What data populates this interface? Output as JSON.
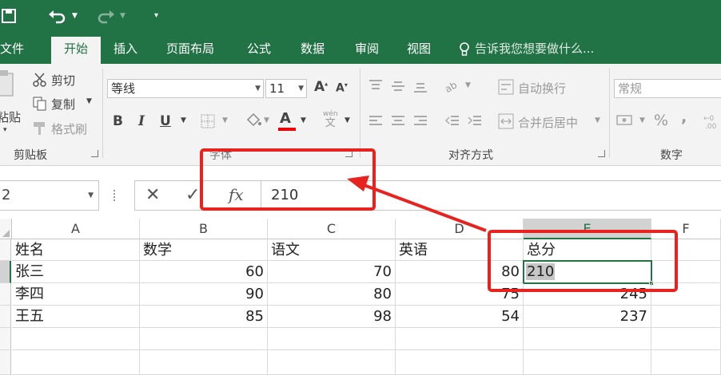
{
  "quick_access": {
    "save_icon": "save-icon",
    "undo_icon": "undo-icon",
    "redo_icon": "redo-icon",
    "customize_icon": "customize-qat-icon"
  },
  "tabs": [
    {
      "label": "文件",
      "active": false
    },
    {
      "label": "开始",
      "active": true
    },
    {
      "label": "插入",
      "active": false
    },
    {
      "label": "页面布局",
      "active": false
    },
    {
      "label": "公式",
      "active": false
    },
    {
      "label": "数据",
      "active": false
    },
    {
      "label": "审阅",
      "active": false
    },
    {
      "label": "视图",
      "active": false
    }
  ],
  "tell_me": "告诉我您想要做什么...",
  "ribbon": {
    "clipboard": {
      "paste": "粘贴",
      "cut": "剪切",
      "copy": "复制",
      "format_painter": "格式刷",
      "group_label": "剪贴板"
    },
    "font": {
      "font_name": "等线",
      "font_size": "11",
      "bold": "B",
      "italic": "I",
      "underline": "U",
      "font_color_letter": "A",
      "phonetic_top": "wén",
      "phonetic_bottom": "文",
      "group_label": "字体"
    },
    "alignment": {
      "wrap_text": "自动换行",
      "merge_center": "合并后居中",
      "group_label": "对齐方式"
    },
    "number": {
      "format": "常规",
      "percent": "%",
      "comma": ",",
      "group_label": "数字"
    }
  },
  "formula_bar": {
    "name_box": "2",
    "cancel_icon": "✕",
    "enter_icon": "✓",
    "fx": "fx",
    "value": "210"
  },
  "sheet": {
    "columns": [
      "A",
      "B",
      "C",
      "D",
      "E",
      "F"
    ],
    "selected_column": "E",
    "rows": [
      [
        "姓名",
        "数学",
        "语文",
        "英语",
        "总分"
      ],
      [
        "张三",
        "60",
        "70",
        "80",
        "210"
      ],
      [
        "李四",
        "90",
        "80",
        "75",
        "245"
      ],
      [
        "王五",
        "85",
        "98",
        "54",
        "237"
      ]
    ],
    "active_cell_value": "210"
  },
  "colors": {
    "brand": "#217346",
    "annotation": "#e8231f"
  }
}
